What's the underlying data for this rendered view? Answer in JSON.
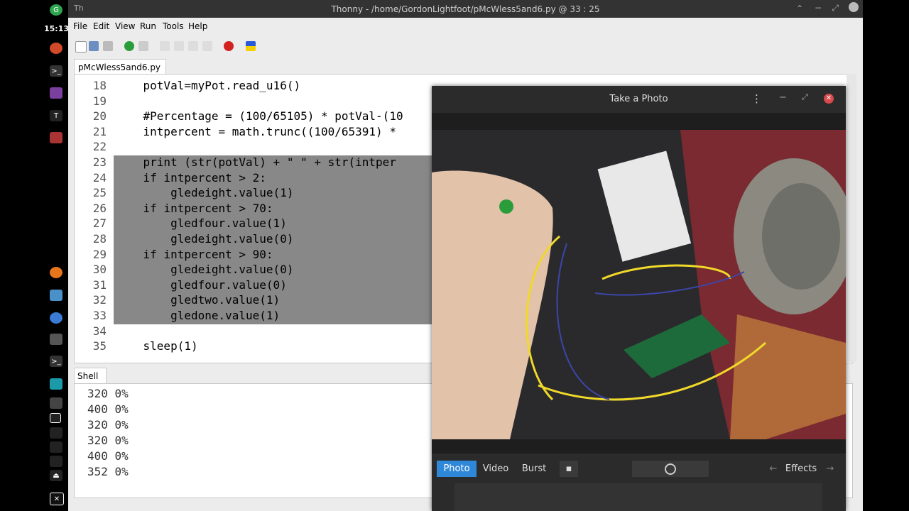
{
  "panel": {
    "clock": "15:13"
  },
  "window": {
    "title": "Thonny  -  /home/GordonLightfoot/pMcWless5and6.py  @  33 : 25"
  },
  "menu": [
    "File",
    "Edit",
    "View",
    "Run",
    "Tools",
    "Help"
  ],
  "editor_tab": "pMcWless5and6.py",
  "editor": {
    "lines": [
      {
        "n": "18",
        "code": "    potVal=myPot.read_u16()"
      },
      {
        "n": "19",
        "code": ""
      },
      {
        "n": "20",
        "code": "    #Percentage = (100/65105) * potVal-(10"
      },
      {
        "n": "21",
        "code": "    intpercent = math.trunc((100/65391) *"
      },
      {
        "n": "22",
        "code": ""
      },
      {
        "n": "23",
        "code": "    print (str(potVal) + \" \" + str(intper"
      },
      {
        "n": "24",
        "code": "    if intpercent > 2:"
      },
      {
        "n": "25",
        "code": "        gledeight.value(1)"
      },
      {
        "n": "26",
        "code": "    if intpercent > 70:"
      },
      {
        "n": "27",
        "code": "        gledfour.value(1)"
      },
      {
        "n": "28",
        "code": "        gledeight.value(0)"
      },
      {
        "n": "29",
        "code": "    if intpercent > 90:"
      },
      {
        "n": "30",
        "code": "        gledeight.value(0)"
      },
      {
        "n": "31",
        "code": "        gledfour.value(0)"
      },
      {
        "n": "32",
        "code": "        gledtwo.value(1)"
      },
      {
        "n": "33",
        "code": "        gledone.value(1)"
      },
      {
        "n": "34",
        "code": ""
      },
      {
        "n": "35",
        "code": "    sleep(1)"
      }
    ]
  },
  "shell_tab": "Shell",
  "shell": {
    "output": [
      "320 0%",
      "400 0%",
      "320 0%",
      "320 0%",
      "400 0%",
      "352 0%"
    ]
  },
  "camera": {
    "title": "Take a Photo",
    "modes": [
      "Photo",
      "Video",
      "Burst"
    ],
    "active_mode": "Photo",
    "effects_label": "Effects"
  }
}
